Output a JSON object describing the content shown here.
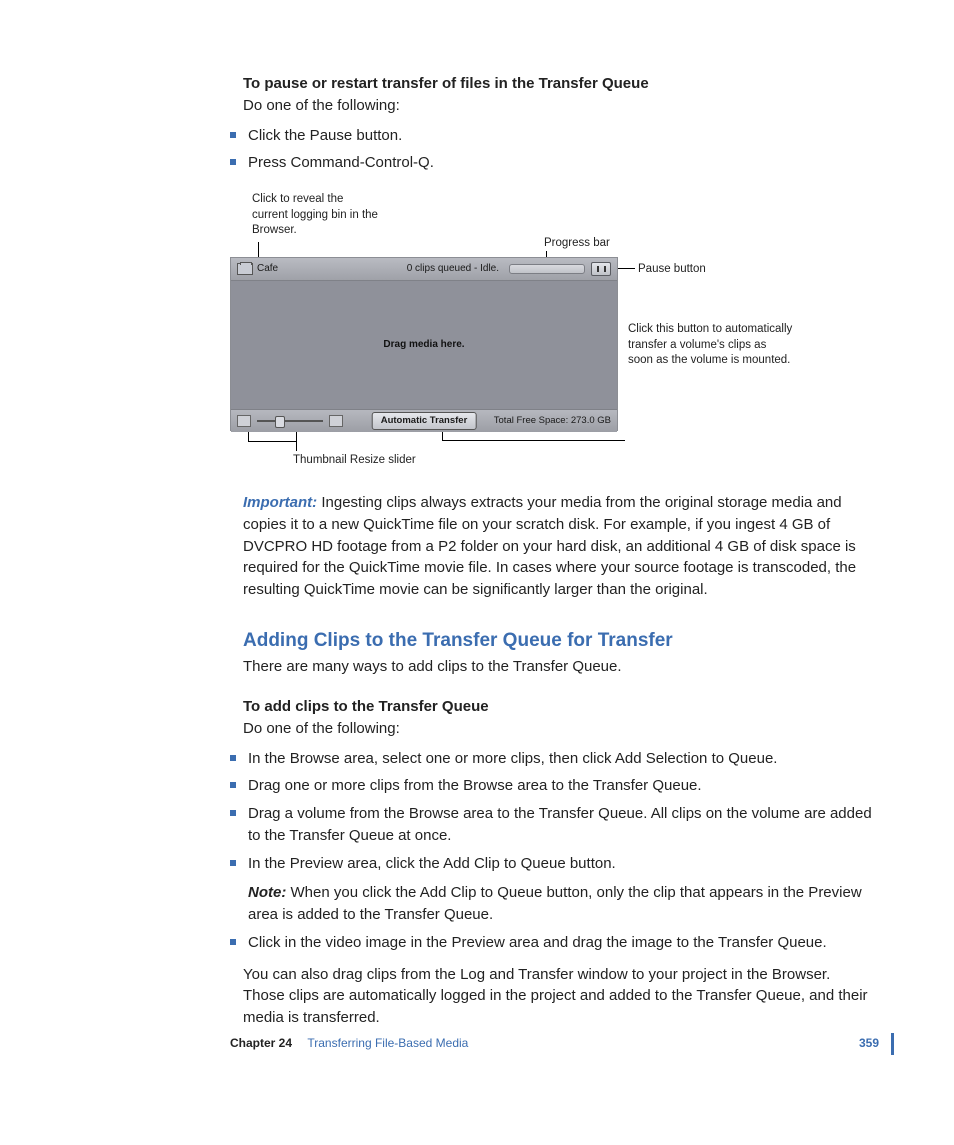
{
  "header": {
    "title": "To pause or restart transfer of files in the Transfer Queue",
    "subtitle": "Do one of the following:"
  },
  "list1": {
    "i0": "Click the Pause button.",
    "i1": "Press Command-Control-Q."
  },
  "figure": {
    "callout_reveal": "Click to reveal the current logging bin in the Browser.",
    "callout_progress": "Progress bar",
    "callout_pause": "Pause button",
    "callout_auto": "Click this button to automatically transfer a volume's clips as soon as  the volume is mounted.",
    "callout_slider": "Thumbnail Resize slider",
    "shot": {
      "bin_name": "Cafe",
      "queue_status": "0 clips queued - Idle.",
      "drop_hint": "Drag media here.",
      "auto_label": "Automatic Transfer",
      "free_space": "Total Free Space: 273.0 GB"
    }
  },
  "important": {
    "label": "Important:",
    "text": "  Ingesting clips always extracts your media from the original storage media and copies it to a new QuickTime file on your scratch disk. For example, if you ingest 4 GB of DVCPRO HD footage from a P2 folder on your hard disk, an additional 4 GB of disk space is required for the QuickTime movie file. In cases where your source footage is transcoded, the resulting QuickTime movie can be significantly larger than the original."
  },
  "section": {
    "heading": "Adding Clips to the Transfer Queue for Transfer",
    "intro": "There are many ways to add clips to the Transfer Queue.",
    "subhead": "To add clips to the Transfer Queue",
    "subtext": "Do one of the following:"
  },
  "list2": {
    "i0": "In the Browse area, select one or more clips, then click Add Selection to Queue.",
    "i1": "Drag one or more clips from the Browse area to the Transfer Queue.",
    "i2": "Drag a volume from the Browse area to the Transfer Queue. All clips on the volume are added to the Transfer Queue at once.",
    "i3": "In the Preview area, click the Add Clip to Queue button.",
    "i3_note_label": "Note:",
    "i3_note_text": "  When you click the Add Clip to Queue button, only the clip that appears in the Preview area is added to the Transfer Queue.",
    "i4": "Click in the video image in the Preview area and drag the image to the Transfer Queue."
  },
  "trailing_para": "You can also drag clips from the Log and Transfer window to your project in the Browser. Those clips are automatically logged in the project and added to the Transfer Queue, and their media is transferred.",
  "footer": {
    "chapter_label": "Chapter 24",
    "title": "Transferring File-Based Media",
    "page": "359"
  }
}
